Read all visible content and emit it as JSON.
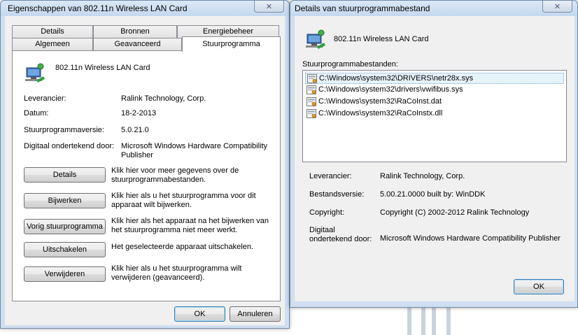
{
  "left_window": {
    "title": "Eigenschappen van 802.11n Wireless LAN Card",
    "close_glyph": "✕",
    "tabs_back": [
      "Details",
      "Bronnen",
      "Energiebeheer"
    ],
    "tabs_front": [
      "Algemeen",
      "Geavanceerd",
      "Stuurprogramma"
    ],
    "active_tab": "Stuurprogramma",
    "device_name": "802.11n Wireless LAN Card",
    "fields": {
      "provider_label": "Leverancier:",
      "provider_value": "Ralink Technology, Corp.",
      "date_label": "Datum:",
      "date_value": "18-2-2013",
      "version_label": "Stuurprogrammaversie:",
      "version_value": "5.0.21.0",
      "signer_label": "Digitaal ondertekend door:",
      "signer_value": "Microsoft Windows Hardware Compatibility Publisher"
    },
    "actions": [
      {
        "label": "Details",
        "desc": "Klik hier voor meer gegevens over de stuurprogrammabestanden."
      },
      {
        "label": "Bijwerken",
        "desc": "Klik hier als u het stuurprogramma voor dit apparaat wilt bijwerken."
      },
      {
        "label": "Vorig stuurprogramma",
        "desc": "Klik hier als het apparaat na het bijwerken van het stuurprogramma niet meer werkt."
      },
      {
        "label": "Uitschakelen",
        "desc": "Het geselecteerde apparaat uitschakelen."
      },
      {
        "label": "Verwijderen",
        "desc": "Klik hier als u het stuurprogramma wilt verwijderen (geavanceerd)."
      }
    ],
    "ok_label": "OK",
    "cancel_label": "Annuleren"
  },
  "right_window": {
    "title": "Details van stuurprogrammabestand",
    "close_glyph": "✕",
    "device_name": "802.11n Wireless LAN Card",
    "files_label": "Stuurprogrammabestanden:",
    "files": [
      "C:\\Windows\\system32\\DRIVERS\\netr28x.sys",
      "C:\\Windows\\system32\\drivers\\vwifibus.sys",
      "C:\\Windows\\system32\\RaCoInst.dat",
      "C:\\Windows\\system32\\RaCoInstx.dll"
    ],
    "selected_file_index": 0,
    "provider_label": "Leverancier:",
    "provider_value": "Ralink Technology, Corp.",
    "file_version_label": "Bestandsversie:",
    "file_version_value": "5.00.21.0000 built by: WinDDK",
    "copyright_label": "Copyright:",
    "copyright_value": "Copyright (C) 2002-2012 Ralink Technology",
    "signer_label": "Digitaal ondertekend door:",
    "signer_value": "Microsoft Windows Hardware Compatibility Publisher",
    "ok_label": "OK"
  },
  "icons": {
    "device": "network-adapter-icon",
    "file": "driver-file-icon",
    "close": "close-icon"
  },
  "colors": {
    "window_frame": "#cfdff0",
    "client_bg": "#f0f0f0",
    "selection": "#e5f3fb",
    "default_button_border": "#3c7fb1"
  }
}
